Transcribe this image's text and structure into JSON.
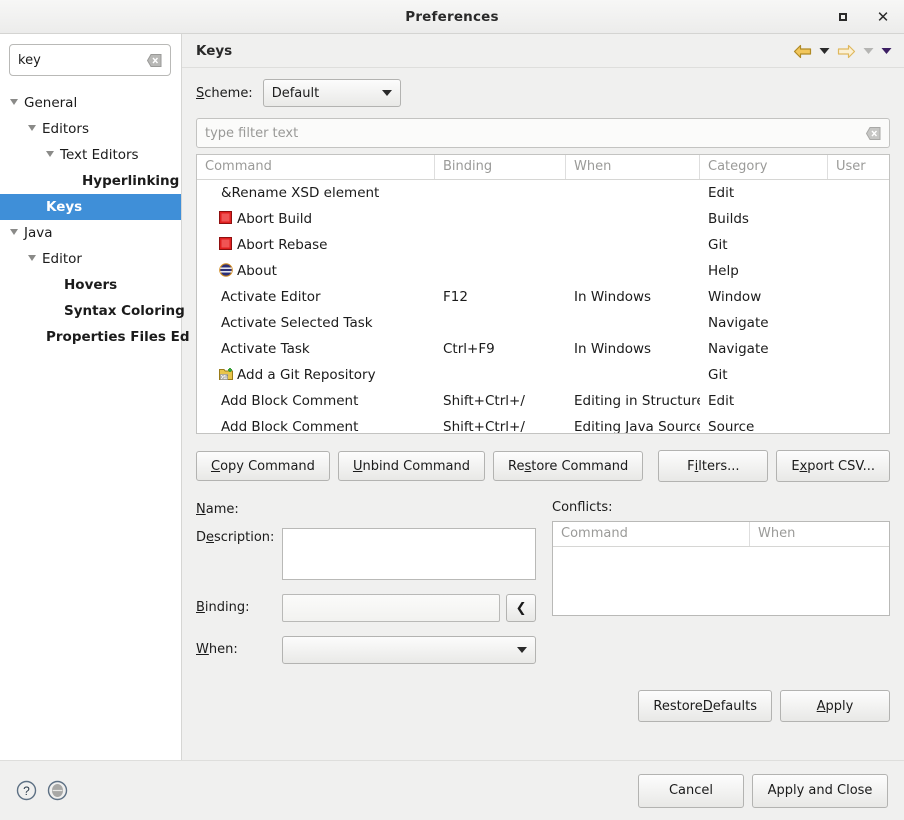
{
  "window": {
    "title": "Preferences",
    "maximize_icon": "maximize-icon",
    "close_icon": "close-icon"
  },
  "sidebar": {
    "search": {
      "value": "key",
      "clear_icon": "clear-icon"
    },
    "items": [
      {
        "label": "General",
        "indent": 0,
        "twisty": "open",
        "selected": false,
        "leaf": false
      },
      {
        "label": "Editors",
        "indent": 1,
        "twisty": "open",
        "selected": false,
        "leaf": false
      },
      {
        "label": "Text Editors",
        "indent": 2,
        "twisty": "open",
        "selected": false,
        "leaf": false
      },
      {
        "label": "Hyperlinking",
        "indent": 3,
        "twisty": "none",
        "selected": false,
        "leaf": true
      },
      {
        "label": "Keys",
        "indent": 1,
        "twisty": "none",
        "selected": true,
        "leaf": true
      },
      {
        "label": "Java",
        "indent": 0,
        "twisty": "open",
        "selected": false,
        "leaf": false
      },
      {
        "label": "Editor",
        "indent": 1,
        "twisty": "open",
        "selected": false,
        "leaf": false
      },
      {
        "label": "Hovers",
        "indent": 2,
        "twisty": "none",
        "selected": false,
        "leaf": true
      },
      {
        "label": "Syntax Coloring",
        "indent": 2,
        "twisty": "none",
        "selected": false,
        "leaf": true
      },
      {
        "label": "Properties Files Ed",
        "indent": 1,
        "twisty": "none",
        "selected": false,
        "leaf": true
      }
    ]
  },
  "page": {
    "title": "Keys",
    "nav": {
      "back_icon": "back-arrow-icon",
      "back_menu_icon": "chevron-down-icon",
      "forward_icon": "forward-arrow-icon",
      "forward_menu_icon": "chevron-down-icon-disabled",
      "more_menu_icon": "chevron-down-icon"
    },
    "scheme": {
      "label_pre": "S",
      "label_post": "cheme:",
      "value": "Default"
    },
    "filter": {
      "placeholder": "type filter text",
      "clear_icon": "clear-icon"
    }
  },
  "keys_table": {
    "columns": [
      "Command",
      "Binding",
      "When",
      "Category",
      "User"
    ],
    "rows": [
      {
        "icon": "",
        "command": "&Rename XSD element",
        "binding": "",
        "when": "",
        "category": "Edit",
        "user": ""
      },
      {
        "icon": "stop-icon",
        "command": "Abort Build",
        "binding": "",
        "when": "",
        "category": "Builds",
        "user": ""
      },
      {
        "icon": "stop-icon",
        "command": "Abort Rebase",
        "binding": "",
        "when": "",
        "category": "Git",
        "user": ""
      },
      {
        "icon": "about-icon",
        "command": "About",
        "binding": "",
        "when": "",
        "category": "Help",
        "user": ""
      },
      {
        "icon": "",
        "command": "Activate Editor",
        "binding": "F12",
        "when": "In Windows",
        "category": "Window",
        "user": ""
      },
      {
        "icon": "",
        "command": "Activate Selected Task",
        "binding": "",
        "when": "",
        "category": "Navigate",
        "user": ""
      },
      {
        "icon": "",
        "command": "Activate Task",
        "binding": "Ctrl+F9",
        "when": "In Windows",
        "category": "Navigate",
        "user": ""
      },
      {
        "icon": "git-repo-icon",
        "command": "Add a Git Repository",
        "binding": "",
        "when": "",
        "category": "Git",
        "user": ""
      },
      {
        "icon": "",
        "command": "Add Block Comment",
        "binding": "Shift+Ctrl+/",
        "when": "Editing in Structure",
        "category": "Edit",
        "user": ""
      },
      {
        "icon": "",
        "command": "Add Block Comment",
        "binding": "Shift+Ctrl+/",
        "when": "Editing Java Source",
        "category": "Source",
        "user": ""
      }
    ]
  },
  "command_buttons": {
    "copy": {
      "mn": "C",
      "rest": "opy Command"
    },
    "unbind": {
      "mn": "U",
      "rest": "nbind Command"
    },
    "restore": {
      "pre": "Re",
      "mn": "s",
      "rest": "tore Command"
    },
    "filters": {
      "pre": "F",
      "mn": "i",
      "rest": "lters..."
    },
    "export": {
      "pre": "E",
      "mn": "x",
      "rest": "port CSV..."
    }
  },
  "details": {
    "name_label": {
      "mn": "N",
      "rest": "ame:"
    },
    "desc_label": {
      "pre": "D",
      "mn": "e",
      "rest": "scription:"
    },
    "binding_label": {
      "mn": "B",
      "rest": "inding:"
    },
    "when_label": {
      "mn": "W",
      "rest": "hen:"
    },
    "name_value": "",
    "description_value": "",
    "binding_value": "",
    "when_value": "",
    "bind_button_icon": "chevron-left-icon",
    "conflicts_label": {
      "pre": "Conf",
      "mn": "l",
      "rest": "icts:"
    },
    "conflicts_columns": [
      "Command",
      "When"
    ],
    "conflicts_rows": []
  },
  "page_buttons": {
    "restore_defaults": {
      "pre": "Restore ",
      "mn": "D",
      "rest": "efaults"
    },
    "apply": {
      "mn": "A",
      "rest": "pply"
    }
  },
  "footer": {
    "help_icon": "help-icon",
    "secondary_icon": "circle-icon",
    "cancel": "Cancel",
    "apply_and_close": "Apply and Close"
  },
  "colors": {
    "selection": "#3f8fd8",
    "window_bg": "#f0f0ef",
    "panel_bg": "#ffffff",
    "stop_red": "#e02020",
    "git_yellow": "#e8c54a"
  }
}
